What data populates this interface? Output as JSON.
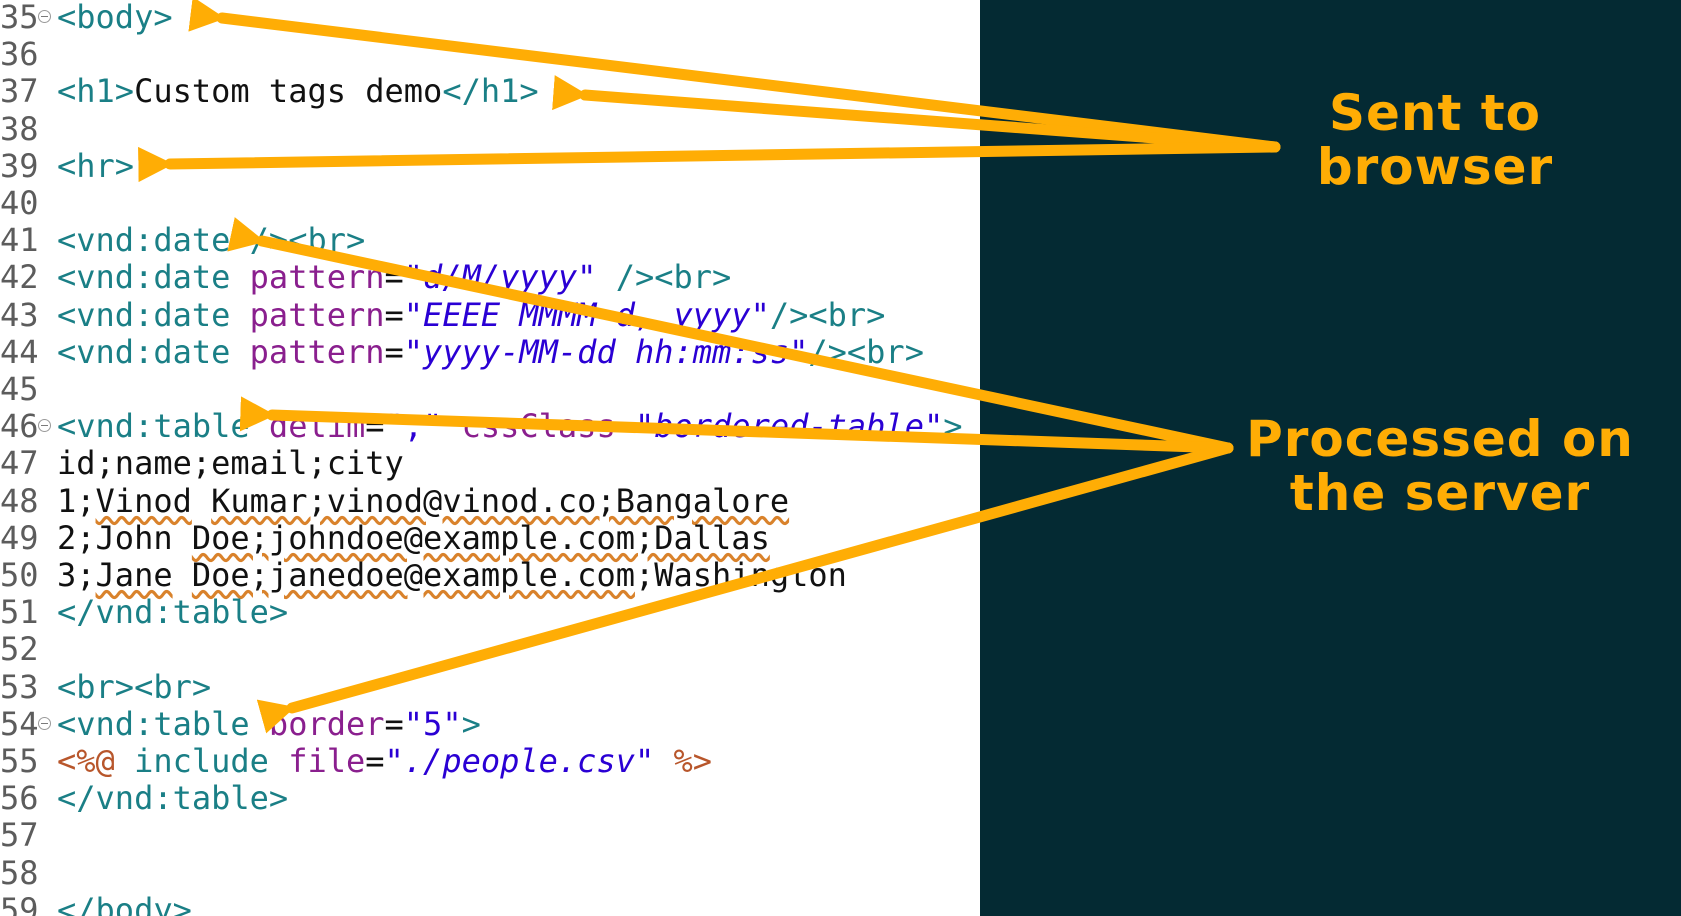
{
  "lines": [
    {
      "n": "35",
      "fold": true,
      "tokens": [
        {
          "c": "t",
          "v": "<body>"
        }
      ]
    },
    {
      "n": "36",
      "fold": false,
      "tokens": []
    },
    {
      "n": "37",
      "fold": false,
      "tokens": [
        {
          "c": "t",
          "v": "<h1>"
        },
        {
          "c": "tx",
          "v": "Custom tags demo"
        },
        {
          "c": "t",
          "v": "</h1>"
        }
      ]
    },
    {
      "n": "38",
      "fold": false,
      "tokens": []
    },
    {
      "n": "39",
      "fold": false,
      "tokens": [
        {
          "c": "t",
          "v": "<hr>"
        }
      ]
    },
    {
      "n": "40",
      "fold": false,
      "tokens": []
    },
    {
      "n": "41",
      "fold": false,
      "tokens": [
        {
          "c": "t",
          "v": "<vnd:date />"
        },
        {
          "c": "t",
          "v": "<br>"
        }
      ]
    },
    {
      "n": "42",
      "fold": false,
      "tokens": [
        {
          "c": "t",
          "v": "<vnd:date "
        },
        {
          "c": "a",
          "v": "pattern"
        },
        {
          "c": "tx",
          "v": "="
        },
        {
          "c": "s",
          "v": "\""
        },
        {
          "c": "si",
          "v": "d/M/yyyy"
        },
        {
          "c": "s",
          "v": "\""
        },
        {
          "c": "t",
          "v": " /><br>"
        }
      ]
    },
    {
      "n": "43",
      "fold": false,
      "tokens": [
        {
          "c": "t",
          "v": "<vnd:date "
        },
        {
          "c": "a",
          "v": "pattern"
        },
        {
          "c": "tx",
          "v": "="
        },
        {
          "c": "s",
          "v": "\""
        },
        {
          "c": "si",
          "v": "EEEE MMMM d, yyyy"
        },
        {
          "c": "s",
          "v": "\""
        },
        {
          "c": "t",
          "v": "/><br>"
        }
      ]
    },
    {
      "n": "44",
      "fold": false,
      "tokens": [
        {
          "c": "t",
          "v": "<vnd:date "
        },
        {
          "c": "a",
          "v": "pattern"
        },
        {
          "c": "tx",
          "v": "="
        },
        {
          "c": "s",
          "v": "\""
        },
        {
          "c": "si",
          "v": "yyyy-MM-dd hh:mm:ss"
        },
        {
          "c": "s",
          "v": "\""
        },
        {
          "c": "t",
          "v": "/><br>"
        }
      ]
    },
    {
      "n": "45",
      "fold": false,
      "tokens": []
    },
    {
      "n": "46",
      "fold": true,
      "tokens": [
        {
          "c": "t",
          "v": "<vnd:table "
        },
        {
          "c": "a",
          "v": "delim"
        },
        {
          "c": "tx",
          "v": "="
        },
        {
          "c": "s",
          "v": "\";\""
        },
        {
          "c": "tx",
          "v": " "
        },
        {
          "c": "a",
          "v": "cssClass"
        },
        {
          "c": "tx",
          "v": "="
        },
        {
          "c": "s",
          "v": "\""
        },
        {
          "c": "si",
          "v": "bordered-table"
        },
        {
          "c": "s",
          "v": "\""
        },
        {
          "c": "t",
          "v": ">"
        }
      ]
    },
    {
      "n": "47",
      "fold": false,
      "tokens": [
        {
          "c": "tx",
          "v": "id;name;email;city"
        }
      ]
    },
    {
      "n": "48",
      "fold": false,
      "tokens": [
        {
          "c": "tx",
          "v": "1;"
        },
        {
          "c": "tx sq",
          "v": "Vinod"
        },
        {
          "c": "tx",
          "v": " "
        },
        {
          "c": "tx sq",
          "v": "Kumar;vinod@vinod.co;Bangalore"
        }
      ]
    },
    {
      "n": "49",
      "fold": false,
      "tokens": [
        {
          "c": "tx",
          "v": "2;John "
        },
        {
          "c": "tx sq",
          "v": "Doe;johndoe@example.com;Dallas"
        }
      ]
    },
    {
      "n": "50",
      "fold": false,
      "tokens": [
        {
          "c": "tx",
          "v": "3;"
        },
        {
          "c": "tx sq",
          "v": "Jane"
        },
        {
          "c": "tx",
          "v": " "
        },
        {
          "c": "tx sq",
          "v": "Doe;janedoe@example.com"
        },
        {
          "c": "tx",
          "v": ";Washington"
        }
      ]
    },
    {
      "n": "51",
      "fold": false,
      "tokens": [
        {
          "c": "t",
          "v": "</vnd:table>"
        }
      ]
    },
    {
      "n": "52",
      "fold": false,
      "tokens": []
    },
    {
      "n": "53",
      "fold": false,
      "tokens": [
        {
          "c": "t",
          "v": "<br><br>"
        }
      ]
    },
    {
      "n": "54",
      "fold": true,
      "tokens": [
        {
          "c": "t",
          "v": "<vnd:table "
        },
        {
          "c": "a",
          "v": "border"
        },
        {
          "c": "tx",
          "v": "="
        },
        {
          "c": "s",
          "v": "\"5\""
        },
        {
          "c": "t",
          "v": ">"
        }
      ]
    },
    {
      "n": "55",
      "fold": false,
      "tokens": [
        {
          "c": "d",
          "v": "<%@"
        },
        {
          "c": "t",
          "v": " include "
        },
        {
          "c": "a",
          "v": "file"
        },
        {
          "c": "tx",
          "v": "="
        },
        {
          "c": "s",
          "v": "\""
        },
        {
          "c": "si",
          "v": "./people.csv"
        },
        {
          "c": "s",
          "v": "\""
        },
        {
          "c": "tx",
          "v": " "
        },
        {
          "c": "d",
          "v": "%>"
        }
      ]
    },
    {
      "n": "56",
      "fold": false,
      "tokens": [
        {
          "c": "t",
          "v": "</vnd:table>"
        }
      ]
    },
    {
      "n": "57",
      "fold": false,
      "tokens": []
    },
    {
      "n": "58",
      "fold": false,
      "tokens": []
    },
    {
      "n": "59",
      "fold": false,
      "tokens": [
        {
          "c": "t",
          "v": "</body>"
        }
      ]
    }
  ],
  "annotations": {
    "sent_to_browser": [
      "Sent to",
      "browser"
    ],
    "processed_on_server": [
      "Processed on",
      "the server"
    ]
  },
  "colors": {
    "arrow": "#ffad05",
    "panel_background": "#042a33"
  }
}
